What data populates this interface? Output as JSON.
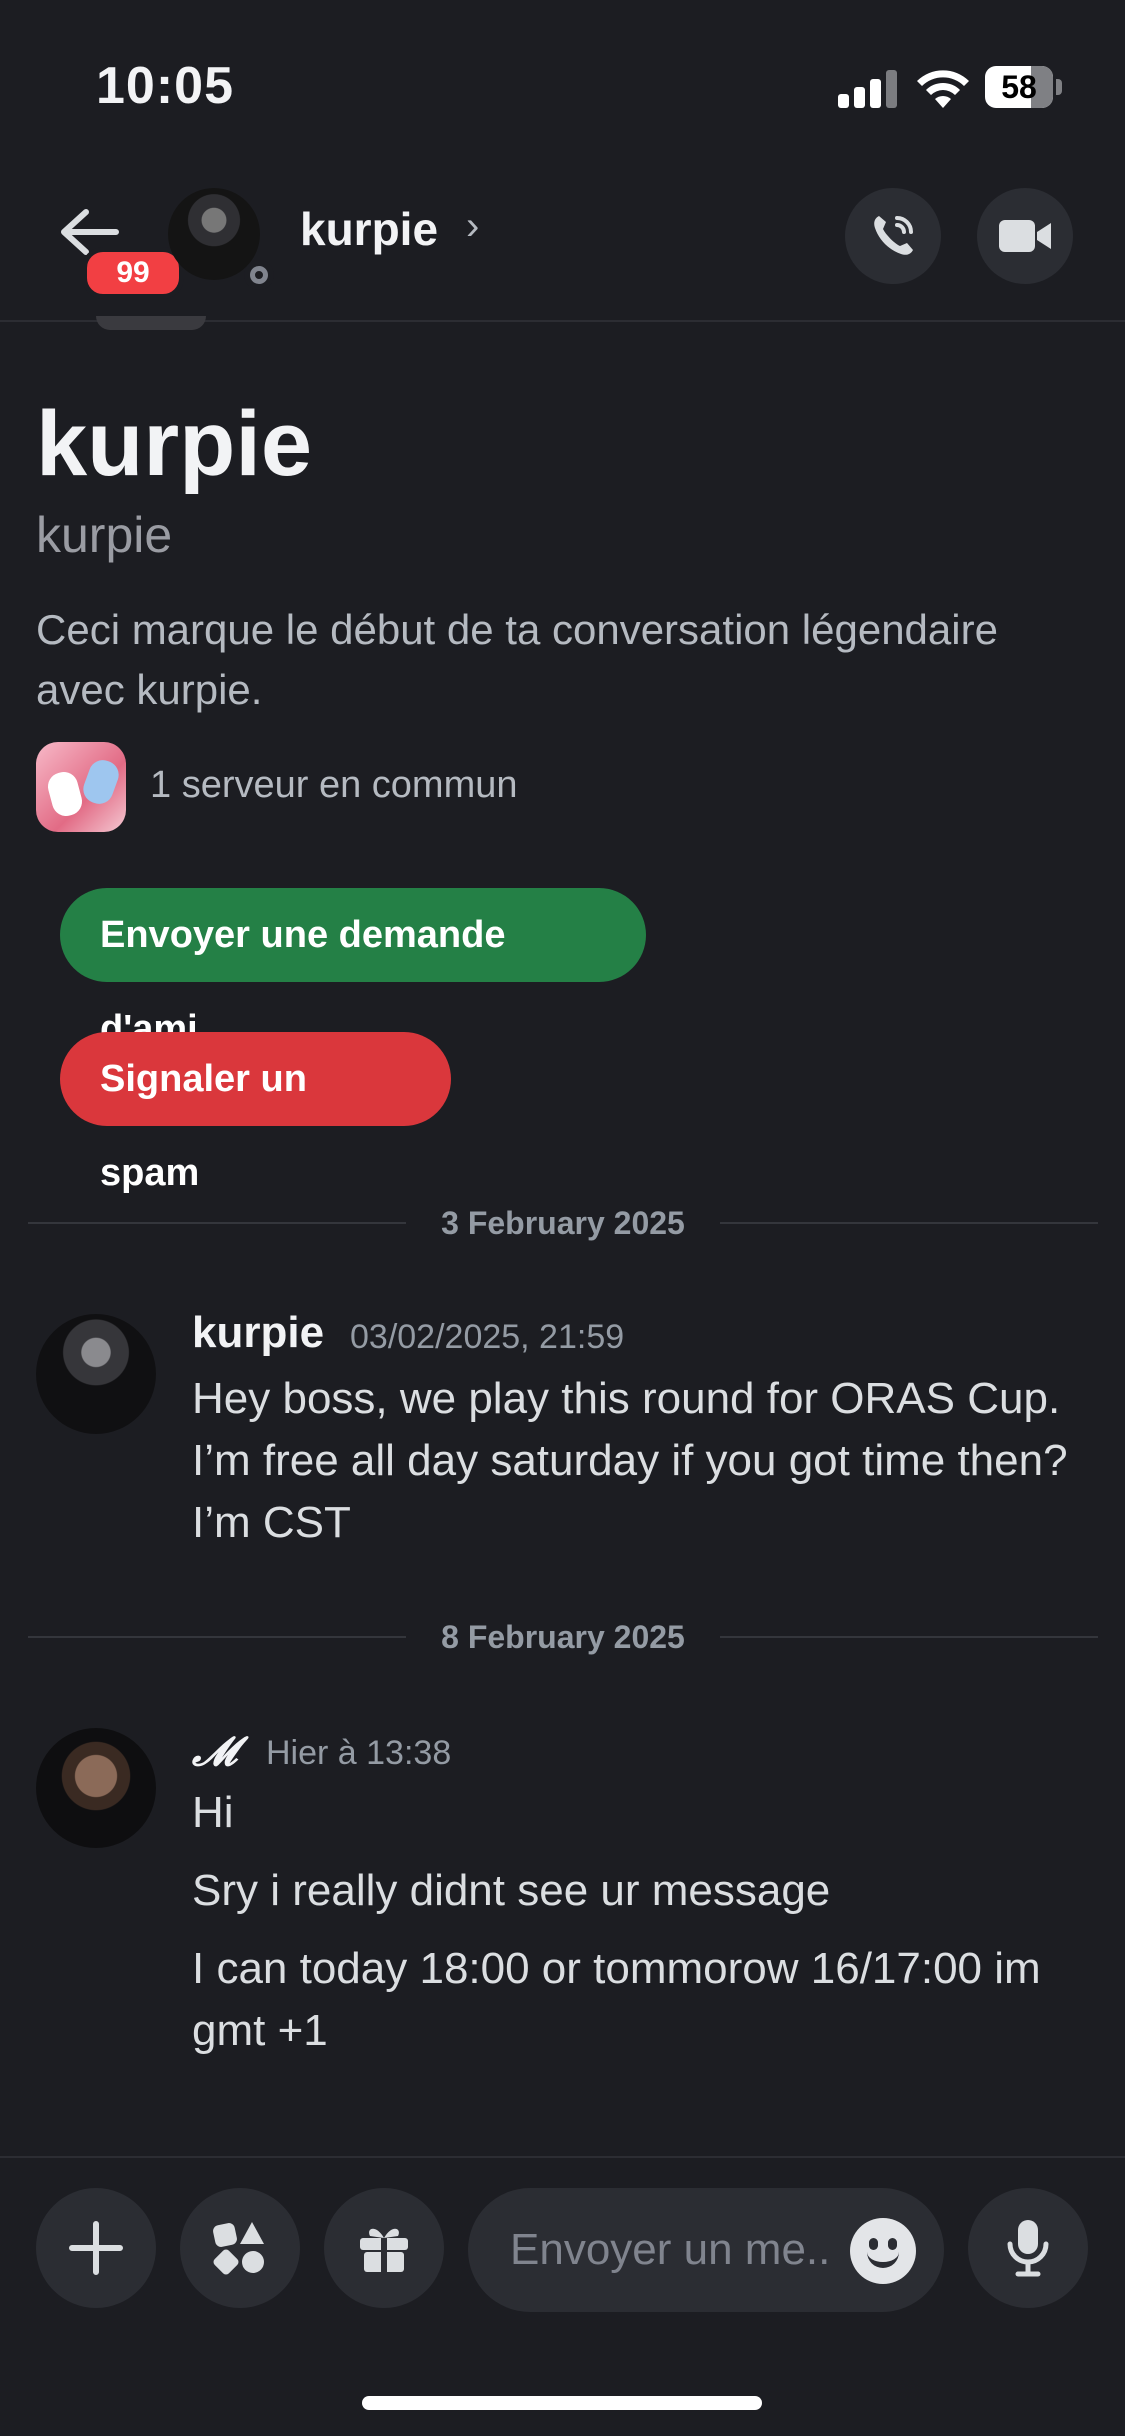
{
  "status_bar": {
    "time": "10:05",
    "battery": "58"
  },
  "header": {
    "unread_badge": "99",
    "username": "kurpie",
    "chevron": "›"
  },
  "intro": {
    "display_name": "kurpie",
    "username": "kurpie",
    "description": "Ceci marque le début de ta conversation légendaire avec kurpie.",
    "mutual_servers": "1 serveur en commun",
    "add_friend_label": "Envoyer une demande d'ami",
    "report_spam_label": "Signaler un spam"
  },
  "dividers": [
    "3 February 2025",
    "8 February 2025"
  ],
  "messages": [
    {
      "author": "kurpie",
      "timestamp": "03/02/2025, 21:59",
      "lines": [
        "Hey boss, we play this round for ORAS Cup. I’m free all day saturday if you got time then? I’m CST"
      ]
    },
    {
      "author": "𝓜",
      "timestamp": "Hier à 13:38",
      "lines": [
        "Hi",
        "Sry i really didnt see ur message",
        "I can today 18:00 or tommorow 16/17:00 im gmt +1"
      ]
    }
  ],
  "composer": {
    "placeholder": "Envoyer un me.."
  },
  "colors": {
    "background": "#1c1d22",
    "green_button": "#248046",
    "red_button": "#da373c",
    "badge": "#f23f43"
  }
}
